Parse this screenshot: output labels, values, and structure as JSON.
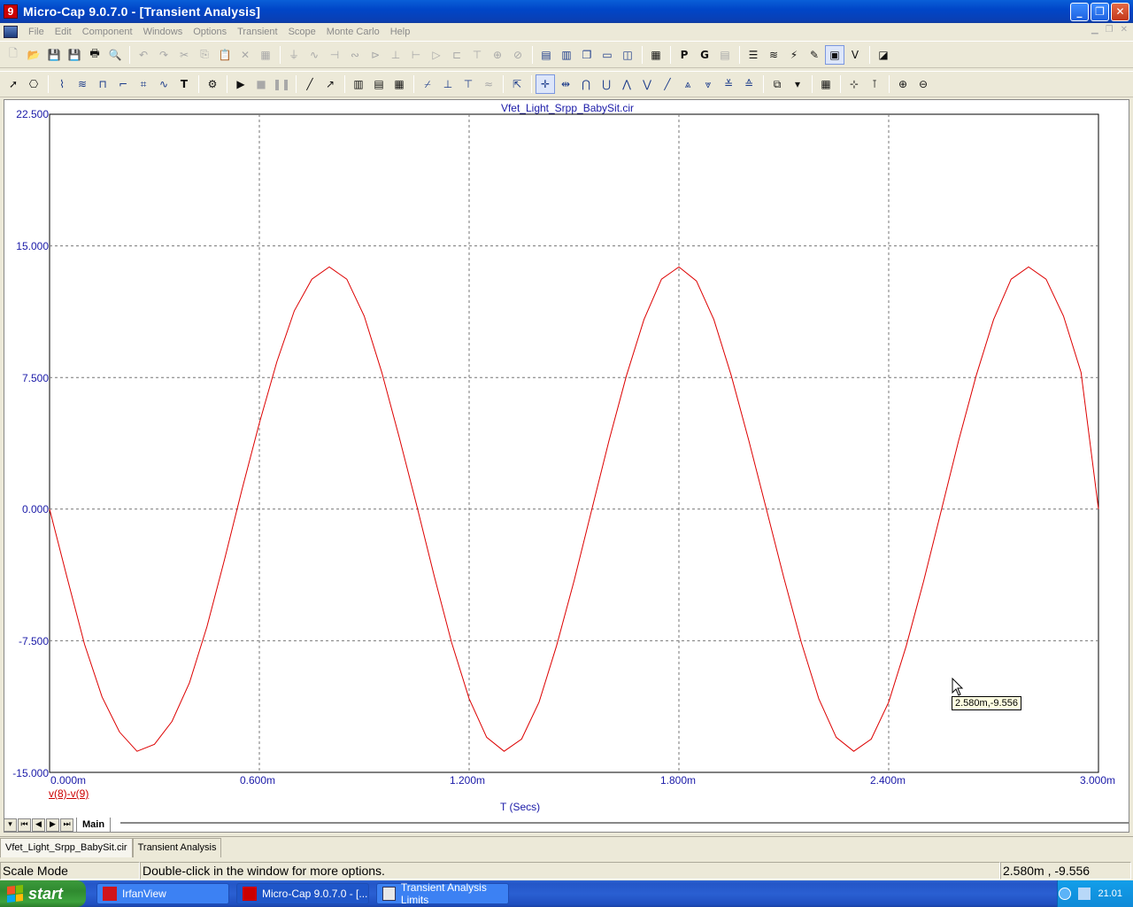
{
  "window": {
    "title": "Micro-Cap 9.0.7.0 - [Transient Analysis]",
    "app_icon": "9",
    "minimize": "_",
    "restore": "❐",
    "close": "✕"
  },
  "menu": [
    "File",
    "Edit",
    "Component",
    "Windows",
    "Options",
    "Transient",
    "Scope",
    "Monte Carlo",
    "Help"
  ],
  "plot": {
    "circuit_name": "Vfet_Light_Srpp_BabySit.cir",
    "trace_name": "v(8)-v(9)",
    "x_axis_title": "T (Secs)",
    "y_tick_labels": [
      "22.500",
      "15.000",
      "7.500",
      "0.000",
      "-7.500",
      "-15.000"
    ],
    "x_tick_labels": [
      "0.000m",
      "0.600m",
      "1.200m",
      "1.800m",
      "2.400m",
      "3.000m"
    ],
    "tooltip": "2.580m,-9.556",
    "trace_color": "#dd0000",
    "axis_color": "#1a1aa8"
  },
  "chart_data": {
    "type": "line",
    "xlabel": "T (Secs)",
    "xlim": [
      0,
      0.003
    ],
    "ylim": [
      -15,
      22.5
    ],
    "grid": true,
    "series": [
      {
        "name": "v(8)-v(9)",
        "x": [
          0,
          5e-05,
          0.0001,
          0.00015,
          0.0002,
          0.00025,
          0.0003,
          0.00035,
          0.0004,
          0.00045,
          0.0005,
          0.00055,
          0.0006,
          0.00065,
          0.0007,
          0.00075,
          0.0008,
          0.00085,
          0.0009,
          0.00095,
          0.001,
          0.00105,
          0.0011,
          0.00115,
          0.0012,
          0.00125,
          0.0013,
          0.00135,
          0.0014,
          0.00145,
          0.0015,
          0.00155,
          0.0016,
          0.00165,
          0.0017,
          0.00175,
          0.0018,
          0.00185,
          0.0019,
          0.00195,
          0.002,
          0.00205,
          0.0021,
          0.00215,
          0.0022,
          0.00225,
          0.0023,
          0.00235,
          0.0024,
          0.00245,
          0.0025,
          0.00255,
          0.0026,
          0.00265,
          0.0027,
          0.00275,
          0.0028,
          0.00285,
          0.0029,
          0.00295,
          0.003
        ],
        "y": [
          0,
          -3.9,
          -7.7,
          -10.7,
          -12.7,
          -13.8,
          -13.4,
          -12.1,
          -9.9,
          -6.7,
          -2.9,
          1.1,
          4.9,
          8.4,
          11.3,
          13.1,
          13.8,
          13.1,
          11.0,
          7.8,
          4.1,
          0.2,
          -3.8,
          -7.6,
          -10.8,
          -13.0,
          -13.8,
          -13.1,
          -11.0,
          -7.8,
          -4.1,
          -0.1,
          3.9,
          7.6,
          10.8,
          13.1,
          13.8,
          13.0,
          10.8,
          7.6,
          3.9,
          0,
          -3.9,
          -7.6,
          -10.8,
          -13.0,
          -13.8,
          -13.1,
          -11.0,
          -7.8,
          -4.1,
          -0.1,
          3.9,
          7.6,
          10.8,
          13.1,
          13.8,
          13.1,
          11.0,
          7.8,
          0
        ]
      }
    ]
  },
  "sheet_tab": "Main",
  "doc_tabs": [
    "Vfet_Light_Srpp_BabySit.cir",
    "Transient Analysis"
  ],
  "status": {
    "mode": "Scale Mode",
    "hint": "Double-click in the window for more options.",
    "coords": "2.580m , -9.556"
  },
  "taskbar": {
    "start": "start",
    "tasks": [
      "IrfanView",
      "Micro-Cap 9.0.7.0 - [...",
      "Transient Analysis Limits"
    ],
    "clock": "21.01"
  }
}
